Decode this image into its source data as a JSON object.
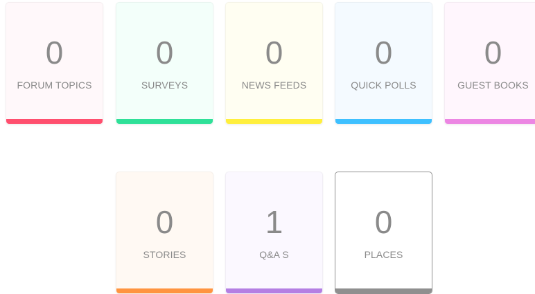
{
  "cards": [
    {
      "count": "0",
      "label": "FORUM TOPICS",
      "bg": "#fff8fa",
      "bar": "#ff4f6e"
    },
    {
      "count": "0",
      "label": "SURVEYS",
      "bg": "#f3fffa",
      "bar": "#2fe098"
    },
    {
      "count": "0",
      "label": "NEWS FEEDS",
      "bg": "#fffef2",
      "bar": "#ffef3d"
    },
    {
      "count": "0",
      "label": "QUICK POLLS",
      "bg": "#f4faff",
      "bar": "#3ec0ff"
    },
    {
      "count": "0",
      "label": "GUEST BOOKS",
      "bg": "#fff6fd",
      "bar": "#ec86e3"
    },
    {
      "count": "0",
      "label": "STORIES",
      "bg": "#fff9f3",
      "bar": "#ff9440"
    },
    {
      "count": "1",
      "label": "Q&A S",
      "bg": "#fbf8ff",
      "bar": "#b47fe3"
    },
    {
      "count": "0",
      "label": "PLACES",
      "bg": "#ffffff",
      "bar": "#8f8f8f"
    }
  ]
}
